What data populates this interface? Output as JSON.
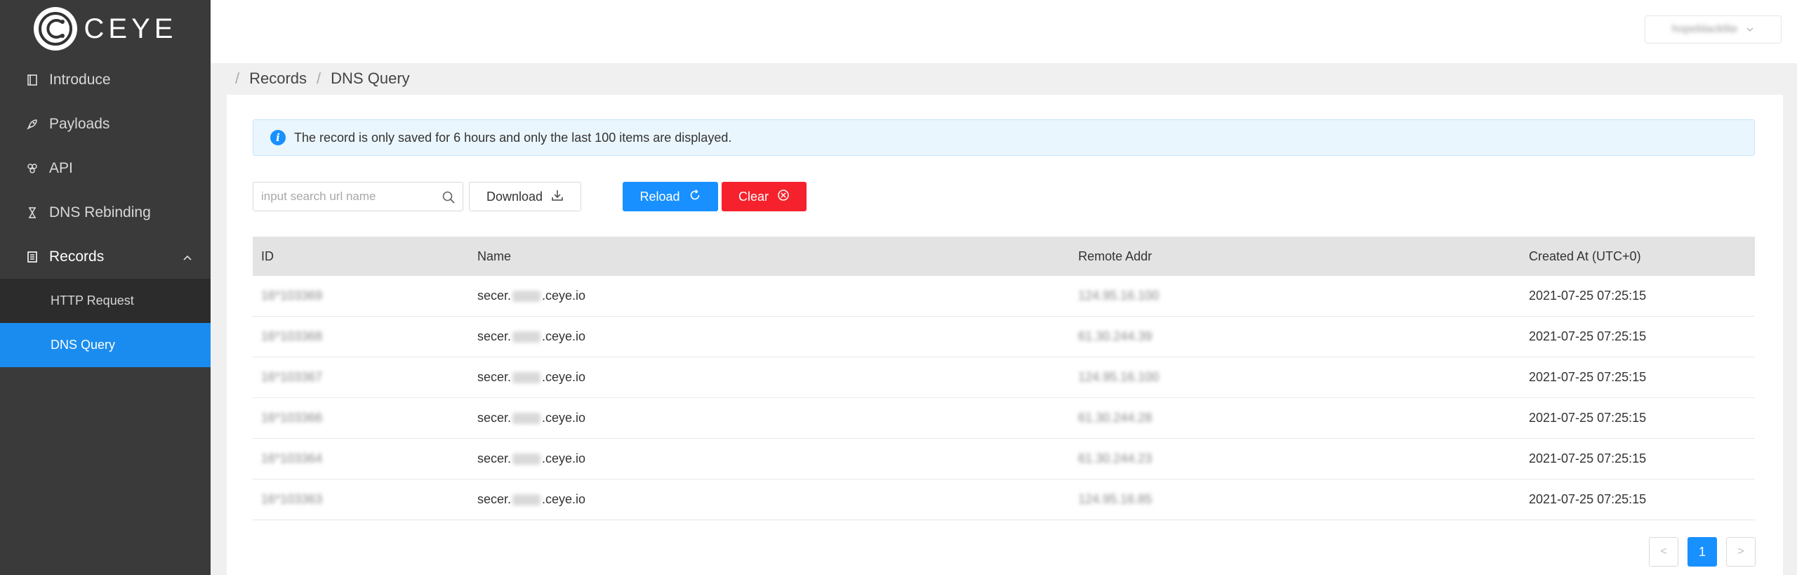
{
  "brand": {
    "name": "CEYE",
    "accent": "#1890ff"
  },
  "sidebar": {
    "items": [
      {
        "label": "Introduce",
        "icon": "book-icon"
      },
      {
        "label": "Payloads",
        "icon": "rocket-icon"
      },
      {
        "label": "API",
        "icon": "api-icon"
      },
      {
        "label": "DNS Rebinding",
        "icon": "hourglass-icon"
      },
      {
        "label": "Records",
        "icon": "records-icon"
      }
    ],
    "sub_items": [
      {
        "label": "HTTP Request"
      },
      {
        "label": "DNS Query"
      }
    ]
  },
  "header": {
    "user": "hopeblacklite"
  },
  "breadcrumb": {
    "items": [
      "Records",
      "DNS Query"
    ],
    "separator": "/"
  },
  "notice": {
    "text": "The record is only saved for 6 hours and only the last 100 items are displayed."
  },
  "toolbar": {
    "search_placeholder": "input search url name",
    "download_label": "Download",
    "reload_label": "Reload",
    "clear_label": "Clear"
  },
  "table": {
    "columns": [
      "ID",
      "Name",
      "Remote Addr",
      "Created At (UTC+0)"
    ],
    "rows": [
      {
        "id": "16*103369",
        "name_prefix": "secer.",
        "name_suffix": ".ceye.io",
        "addr": "124.95.16.100",
        "created": "2021-07-25 07:25:15"
      },
      {
        "id": "16*103368",
        "name_prefix": "secer.",
        "name_suffix": ".ceye.io",
        "addr": "61.30.244.39",
        "created": "2021-07-25 07:25:15"
      },
      {
        "id": "16*103367",
        "name_prefix": "secer.",
        "name_suffix": ".ceye.io",
        "addr": "124.95.16.100",
        "created": "2021-07-25 07:25:15"
      },
      {
        "id": "16*103366",
        "name_prefix": "secer.",
        "name_suffix": ".ceye.io",
        "addr": "61.30.244.28",
        "created": "2021-07-25 07:25:15"
      },
      {
        "id": "16*103364",
        "name_prefix": "secer.",
        "name_suffix": ".ceye.io",
        "addr": "61.30.244.23",
        "created": "2021-07-25 07:25:15"
      },
      {
        "id": "16*103363",
        "name_prefix": "secer.",
        "name_suffix": ".ceye.io",
        "addr": "124.95.16.85",
        "created": "2021-07-25 07:25:15"
      }
    ]
  },
  "pagination": {
    "prev": "<",
    "current": "1",
    "next": ">"
  }
}
